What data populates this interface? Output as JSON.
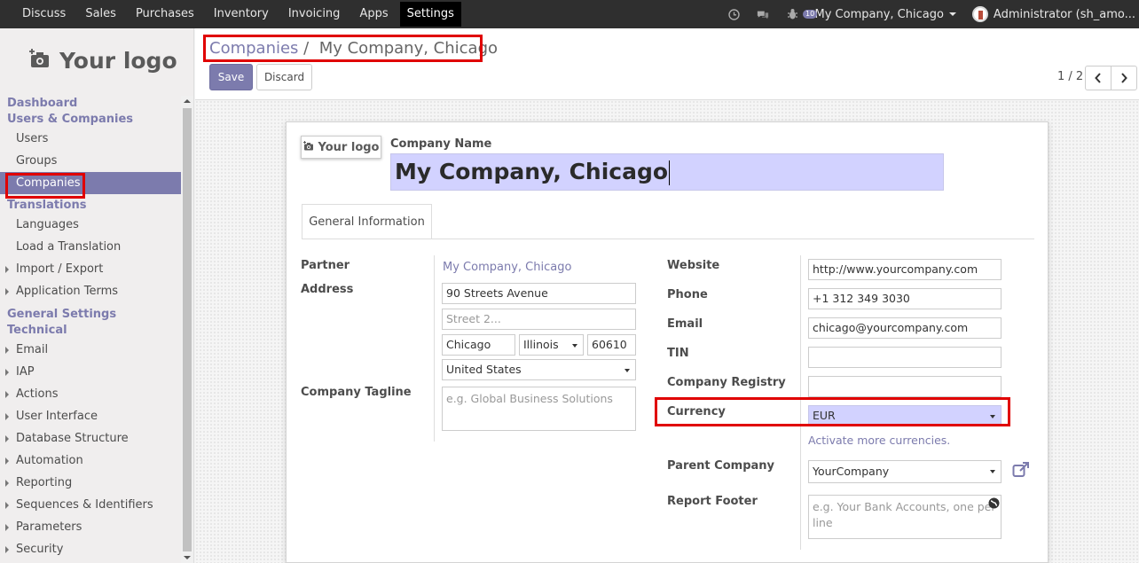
{
  "topbar": {
    "menu": [
      "Discuss",
      "Sales",
      "Purchases",
      "Inventory",
      "Invoicing",
      "Apps",
      "Settings"
    ],
    "active": "Settings",
    "chat_badge": "10",
    "company": "My Company, Chicago",
    "user": "Administrator (sh_amo..."
  },
  "sidebar": {
    "logo_text": "Your logo",
    "items": [
      {
        "type": "head",
        "label": "Dashboard"
      },
      {
        "type": "head",
        "label": "Users & Companies"
      },
      {
        "type": "item",
        "label": "Users"
      },
      {
        "type": "item",
        "label": "Groups"
      },
      {
        "type": "item",
        "label": "Companies",
        "active": true
      },
      {
        "type": "head",
        "label": "Translations"
      },
      {
        "type": "item",
        "label": "Languages"
      },
      {
        "type": "item",
        "label": "Load a Translation"
      },
      {
        "type": "item",
        "label": "Import / Export",
        "arrow": true
      },
      {
        "type": "item",
        "label": "Application Terms",
        "arrow": true
      },
      {
        "type": "head",
        "label": "General Settings"
      },
      {
        "type": "head",
        "label": "Technical"
      },
      {
        "type": "item",
        "label": "Email",
        "arrow": true
      },
      {
        "type": "item",
        "label": "IAP",
        "arrow": true
      },
      {
        "type": "item",
        "label": "Actions",
        "arrow": true
      },
      {
        "type": "item",
        "label": "User Interface",
        "arrow": true
      },
      {
        "type": "item",
        "label": "Database Structure",
        "arrow": true
      },
      {
        "type": "item",
        "label": "Automation",
        "arrow": true
      },
      {
        "type": "item",
        "label": "Reporting",
        "arrow": true
      },
      {
        "type": "item",
        "label": "Sequences & Identifiers",
        "arrow": true
      },
      {
        "type": "item",
        "label": "Parameters",
        "arrow": true
      },
      {
        "type": "item",
        "label": "Security",
        "arrow": true
      }
    ]
  },
  "control_panel": {
    "breadcrumb_parent": "Companies",
    "breadcrumb_sep": "/",
    "breadcrumb_current": "My Company, Chicago",
    "save_label": "Save",
    "discard_label": "Discard",
    "pager": "1 / 2"
  },
  "form": {
    "logo_text": "Your logo",
    "company_name_label": "Company Name",
    "company_name": "My Company, Chicago",
    "tab_label": "General Information",
    "partner_label": "Partner",
    "partner_value": "My Company, Chicago",
    "address_label": "Address",
    "street": "90 Streets Avenue",
    "street2_placeholder": "Street 2...",
    "city": "Chicago",
    "state": "Illinois",
    "zip": "60610",
    "country": "United States",
    "tagline_label": "Company Tagline",
    "tagline_placeholder": "e.g. Global Business Solutions",
    "website_label": "Website",
    "website": "http://www.yourcompany.com",
    "phone_label": "Phone",
    "phone": "+1 312 349 3030",
    "email_label": "Email",
    "email": "chicago@yourcompany.com",
    "tin_label": "TIN",
    "registry_label": "Company Registry",
    "currency_label": "Currency",
    "currency": "EUR",
    "currency_link": "Activate more currencies.",
    "parent_label": "Parent Company",
    "parent": "YourCompany",
    "footer_label": "Report Footer",
    "footer_placeholder": "e.g. Your Bank Accounts, one per line"
  },
  "colors": {
    "accent": "#7c7bad",
    "highlight": "#e00000",
    "topbar": "#2f2f2f"
  }
}
